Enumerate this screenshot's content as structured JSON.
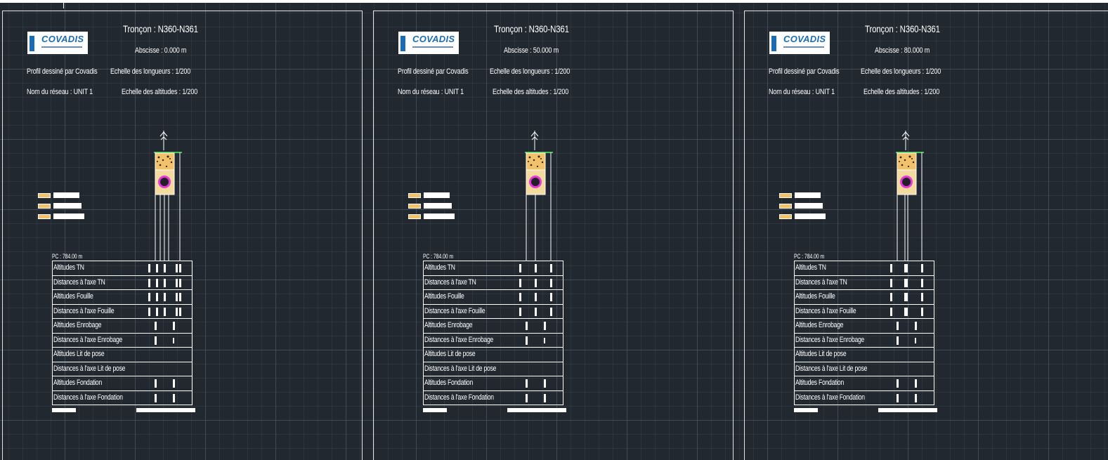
{
  "sheets": [
    {
      "title": "Tronçon : N360-N361",
      "abscisse": "Abscisse : 0.000 m",
      "drawn_by": "Profil dessiné par Covadis",
      "scale_lengths": "Echelle des longueurs : 1/200",
      "network": "Nom du réseau : UNIT 1",
      "scale_altitudes": "Echelle des altitudes : 1/200",
      "pc": "PC : 784.00 m"
    },
    {
      "title": "Tronçon : N360-N361",
      "abscisse": "Abscisse : 50.000 m",
      "drawn_by": "Profil dessiné par Covadis",
      "scale_lengths": "Echelle des longueurs : 1/200",
      "network": "Nom du réseau : UNIT 1",
      "scale_altitudes": "Echelle des altitudes : 1/200",
      "pc": "PC : 784.00 m"
    },
    {
      "title": "Tronçon : N360-N361",
      "abscisse": "Abscisse : 80.000 m",
      "drawn_by": "Profil dessiné par Covadis",
      "scale_lengths": "Echelle des longueurs : 1/200",
      "network": "Nom du réseau : UNIT 1",
      "scale_altitudes": "Echelle des altitudes : 1/200",
      "pc": "PC : 784.00 m"
    }
  ],
  "logo_text": "COVADIS",
  "table_rows": [
    "Altitudes TN",
    "Distances à l'axe TN",
    "Altitudes Fouille",
    "Distances à l'axe Fouille",
    "Altitudes Enrobage",
    "Distances à l'axe Enrobage",
    "Altitudes Lit de pose",
    "Distances à l'axe Lit de pose",
    "Altitudes Fondation",
    "Distances à l'axe Fondation"
  ],
  "colors": {
    "background": "#212830",
    "line": "#ffffff",
    "gravel": "#f3c268",
    "pipe_ring": "#e838d8",
    "logo_blue": "#1a6cb4",
    "ground": "#3fc34a"
  },
  "icons": [
    "covadis-logo",
    "north-arrow-icon",
    "pipe-section-icon"
  ]
}
